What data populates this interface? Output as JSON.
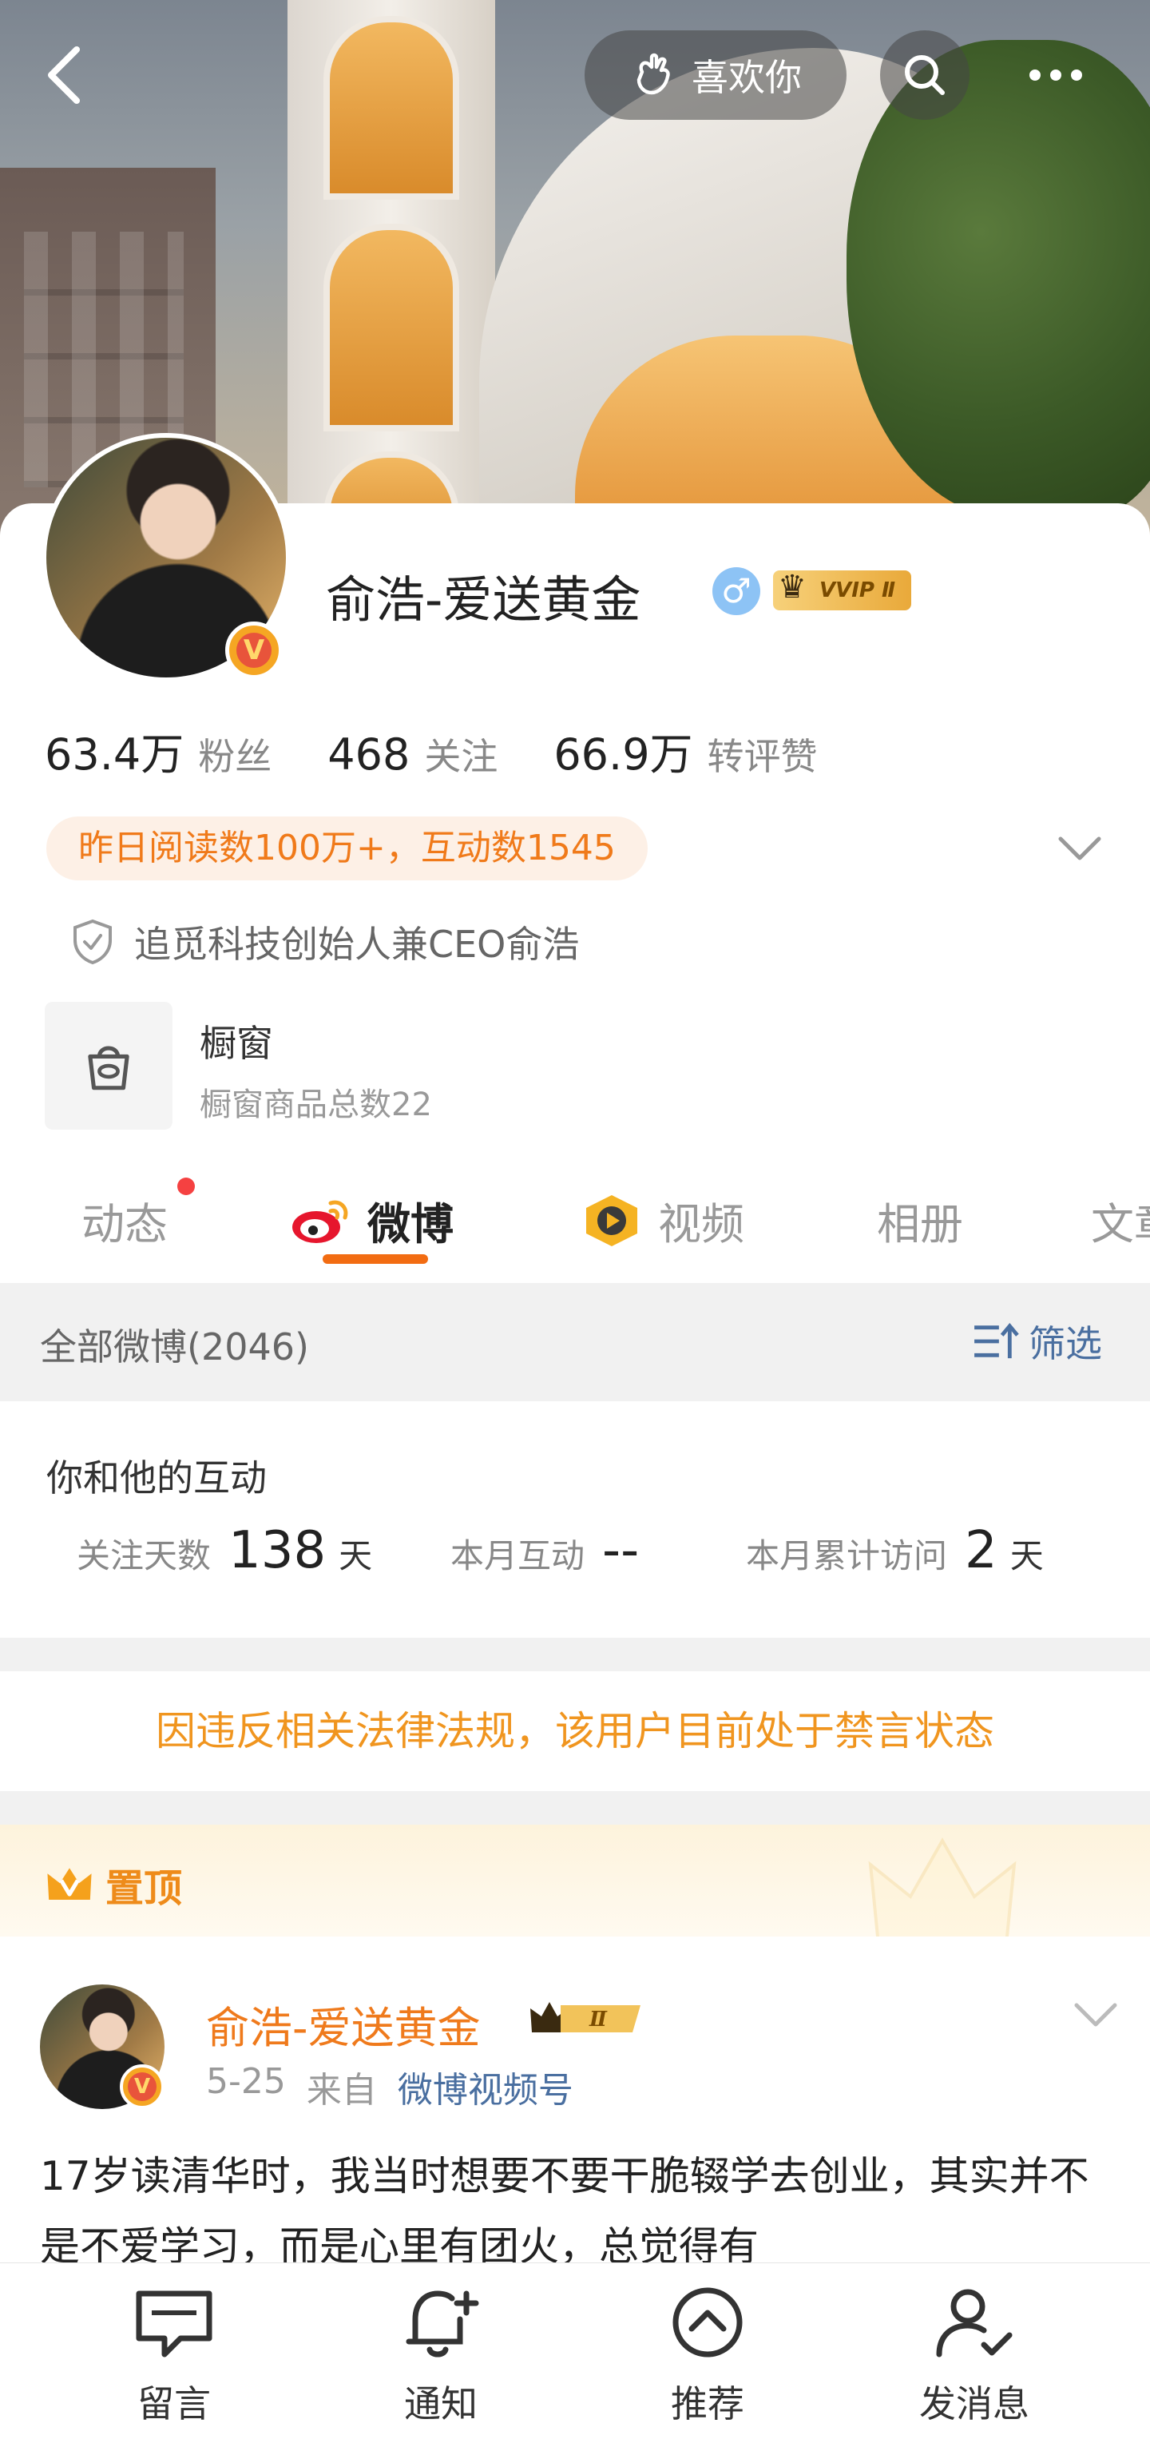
{
  "topbar": {
    "like_label": "喜欢你"
  },
  "profile": {
    "username": "俞浩-爱送黄金",
    "gender_symbol": "♂",
    "vip_badge": "VVIP Ⅱ",
    "verified_mark": "V",
    "stats": [
      {
        "value": "63.4万",
        "label": "粉丝"
      },
      {
        "value": "468",
        "label": "关注"
      },
      {
        "value": "66.9万",
        "label": "转评赞"
      }
    ],
    "read_tag": "昨日阅读数100万+，互动数1545",
    "verification": "追觅科技创始人兼CEO俞浩",
    "shop": {
      "title": "橱窗",
      "subtitle": "橱窗商品总数22"
    }
  },
  "tabs": [
    {
      "label": "动态"
    },
    {
      "label": "微博"
    },
    {
      "label": "视频"
    },
    {
      "label": "相册"
    },
    {
      "label": "文章"
    }
  ],
  "filter": {
    "title": "全部微博(2046)",
    "button": "筛选"
  },
  "interaction": {
    "title": "你和他的互动",
    "items": [
      {
        "label": "关注天数",
        "value": "138",
        "unit": "天"
      },
      {
        "label": "本月互动",
        "value": "--",
        "unit": ""
      },
      {
        "label": "本月累计访问",
        "value": "2",
        "unit": "天"
      }
    ]
  },
  "ban_notice": "因违反相关法律法规，该用户目前处于禁言状态",
  "pinned_label": "置顶",
  "post": {
    "author": "俞浩-爱送黄金",
    "date": "5-25",
    "from_label": "来自",
    "source": "微博视频号",
    "text": "17岁读清华时，我当时想要不要干脆辍学去创业，其实并不是不爱学习，而是心里有团火，总觉得有"
  },
  "bottom_nav": [
    {
      "label": "留言"
    },
    {
      "label": "通知"
    },
    {
      "label": "推荐"
    },
    {
      "label": "发消息"
    }
  ],
  "colors": {
    "accent_orange": "#f26c12",
    "ban_text": "#f0951f",
    "link_blue": "#4a6fa0"
  }
}
